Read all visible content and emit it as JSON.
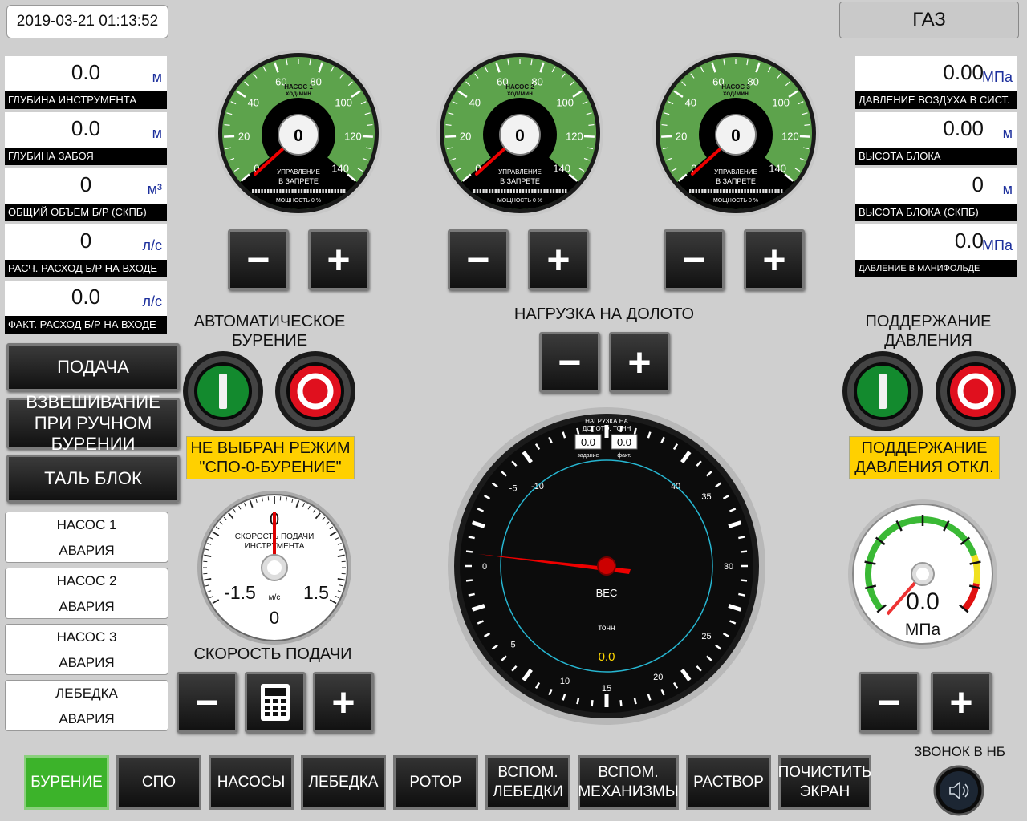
{
  "datetime": "2019-03-21 01:13:52",
  "gas_button": "ГАЗ",
  "left_readouts": [
    {
      "value": "0.0",
      "unit": "м",
      "label": "ГЛУБИНА ИНСТРУМЕНТА"
    },
    {
      "value": "0.0",
      "unit": "м",
      "label": "ГЛУБИНА ЗАБОЯ"
    },
    {
      "value": "0",
      "unit": "м³",
      "label": "ОБЩИЙ ОБЪЕМ Б/Р (СКПБ)"
    },
    {
      "value": "0",
      "unit": "л/с",
      "label": "РАСЧ. РАСХОД Б/Р НА ВХОДЕ"
    },
    {
      "value": "0.0",
      "unit": "л/с",
      "label": "ФАКТ. РАСХОД Б/Р НА ВХОДЕ"
    }
  ],
  "right_readouts": [
    {
      "value": "0.00",
      "unit": "МПа",
      "label": "ДАВЛЕНИЕ ВОЗДУХА В СИСТ."
    },
    {
      "value": "0.00",
      "unit": "м",
      "label": "ВЫСОТА БЛОКА"
    },
    {
      "value": "0",
      "unit": "м",
      "label": "ВЫСОТА БЛОКА (СКПБ)"
    },
    {
      "value": "0.0",
      "unit": "МПа",
      "label": "ДАВЛЕНИЕ В МАНИФОЛЬДЕ"
    }
  ],
  "pumps": [
    {
      "title": "НАСОС 1",
      "units": "ход/мин",
      "value": "0",
      "status1": "УПРАВЛЕНИЕ",
      "status2": "В ЗАПРЕТЕ",
      "power": "МОЩНОСТЬ 0 %"
    },
    {
      "title": "НАСОС 2",
      "units": "ход/мин",
      "value": "0",
      "status1": "УПРАВЛЕНИЕ",
      "status2": "В ЗАПРЕТЕ",
      "power": "МОЩНОСТЬ 0 %"
    },
    {
      "title": "НАСОС 3",
      "units": "ход/мин",
      "value": "0",
      "status1": "УПРАВЛЕНИЕ",
      "status2": "В ЗАПРЕТЕ",
      "power": "МОЩНОСТЬ 0 %"
    }
  ],
  "pump_scale": [
    "0",
    "20",
    "40",
    "60",
    "80",
    "100",
    "120",
    "140"
  ],
  "controls": {
    "minus": "−",
    "plus": "+"
  },
  "mode_buttons": {
    "feed": "ПОДАЧА",
    "weighing": "ВЗВЕШИВАНИЕ ПРИ РУЧНОМ БУРЕНИИ",
    "talblock": "ТАЛЬ БЛОК"
  },
  "alarms": [
    {
      "name": "НАСОС 1",
      "state": "АВАРИЯ"
    },
    {
      "name": "НАСОС 2",
      "state": "АВАРИЯ"
    },
    {
      "name": "НАСОС 3",
      "state": "АВАРИЯ"
    },
    {
      "name": "ЛЕБЕДКА",
      "state": "АВАРИЯ"
    }
  ],
  "auto_drilling": {
    "title": "АВТОМАТИЧЕСКОЕ БУРЕНИЕ",
    "status": "НЕ ВЫБРАН РЕЖИМ \"СПО-0-БУРЕНИЕ\""
  },
  "bit_load": {
    "title": "НАГРУЗКА НА ДОЛОТО"
  },
  "pressure_hold": {
    "title": "ПОДДЕРЖАНИЕ ДАВЛЕНИЯ",
    "status": "ПОДДЕРЖАНИЕ ДАВЛЕНИЯ ОТКЛ."
  },
  "feed_speed_gauge": {
    "title1": "СКОРОСТЬ ПОДАЧИ",
    "title2": "ИНСТРУМЕНТА",
    "top": "0",
    "left": "-1.5",
    "right": "1.5",
    "bottom": "0",
    "unit": "м/с"
  },
  "feed_speed": {
    "title": "СКОРОСТЬ ПОДАЧИ"
  },
  "weight_gauge": {
    "header1": "НАГРУЗКА НА",
    "header2": "ДОЛОТО, ТОНН",
    "set_value": "0.0",
    "set_label": "задание",
    "fact_value": "0.0",
    "fact_label": "факт.",
    "sub_scale": [
      "-10",
      "40"
    ],
    "scale": [
      "-5",
      "0",
      "5",
      "10",
      "15",
      "20",
      "25",
      "30",
      "35"
    ],
    "title": "ВЕС",
    "unit": "тонн",
    "value": "0.0"
  },
  "pressure_gauge": {
    "value": "0.0",
    "unit": "МПа"
  },
  "bell": {
    "label": "ЗВОНОК В НБ"
  },
  "tabs": [
    {
      "label": "БУРЕНИЕ",
      "active": true
    },
    {
      "label": "СПО"
    },
    {
      "label": "НАСОСЫ"
    },
    {
      "label": "ЛЕБЕДКА"
    },
    {
      "label": "РОТОР"
    },
    {
      "label": "ВСПОМ. ЛЕБЕДКИ"
    },
    {
      "label": "ВСПОМ. МЕХАНИЗМЫ"
    },
    {
      "label": "РАСТВОР"
    },
    {
      "label": "ПОЧИСТИТЬ ЭКРАН"
    }
  ],
  "colors": {
    "gauge_green": "#5da34c",
    "active_tab": "#3cb32a",
    "status_yellow": "#ffd000",
    "needle": "#e00000",
    "weight_value": "#ffd700"
  }
}
